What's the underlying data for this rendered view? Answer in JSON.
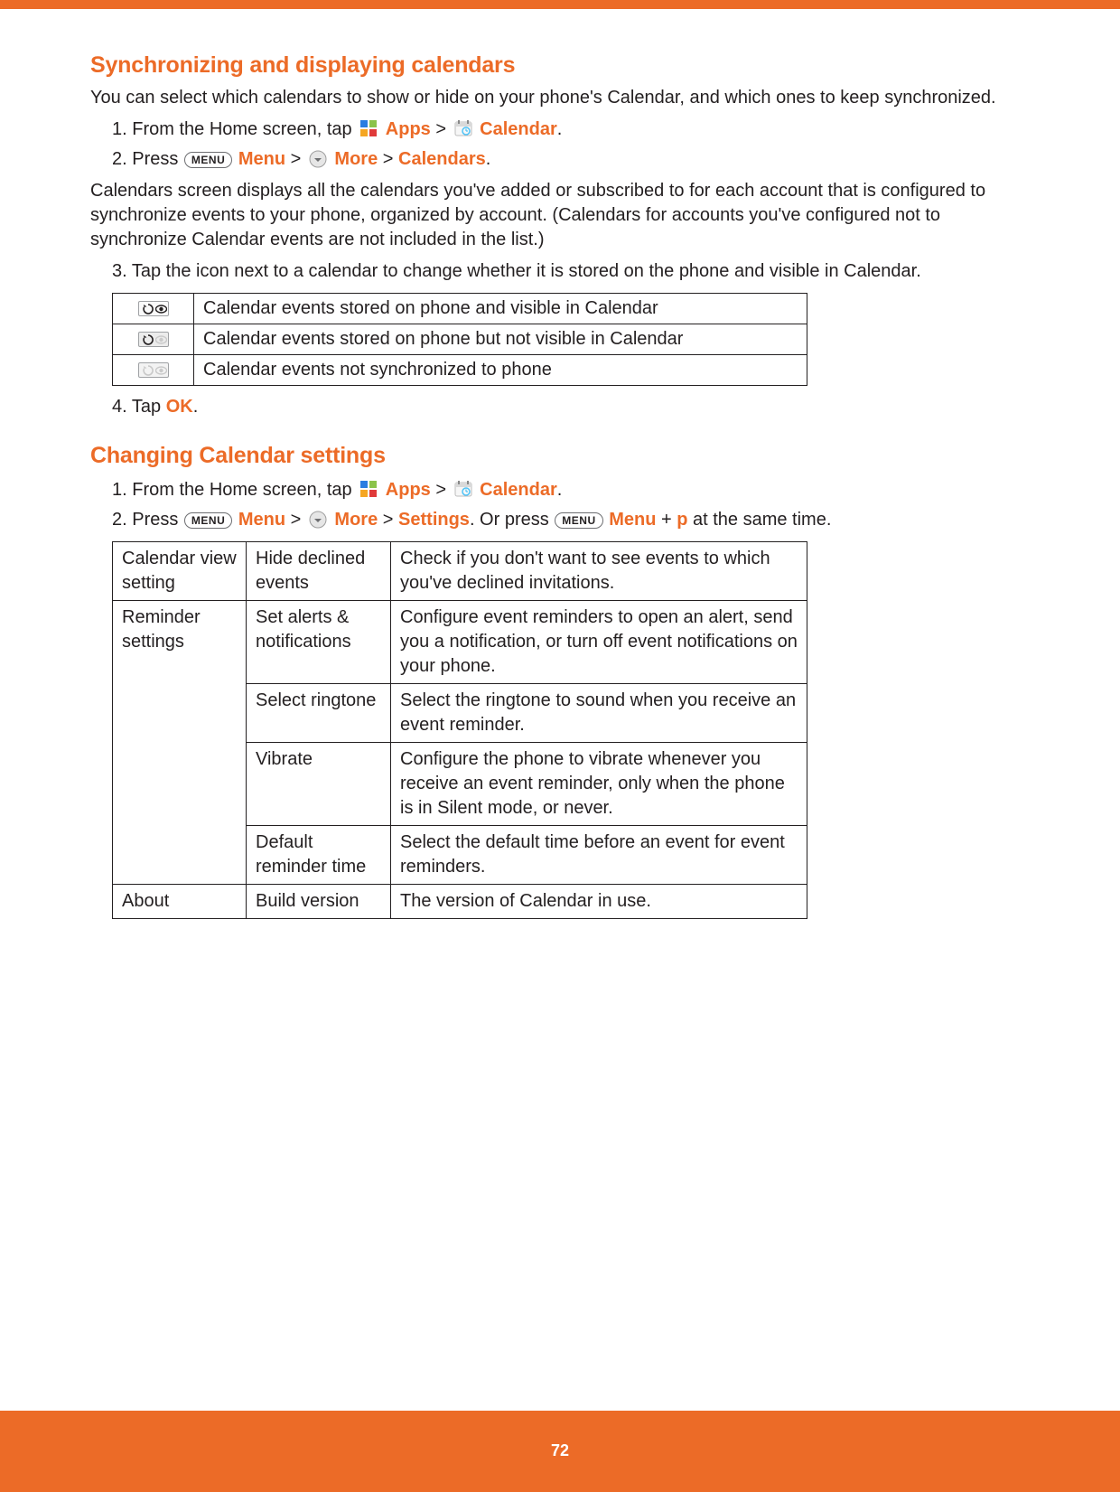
{
  "section1": {
    "title": "Synchronizing and displaying calendars",
    "intro": "You can select which calendars to show or hide on your phone's Calendar, and which ones to keep synchronized.",
    "step1_prefix": "1. From the Home screen, tap ",
    "apps_label": "Apps",
    "sep_gt": " > ",
    "calendar_label": "Calendar",
    "step2_prefix": "2. Press ",
    "menu_key": "MENU",
    "menu_label": "Menu",
    "more_label": "More",
    "calendars_label": "Calendars",
    "period": ".",
    "para2": "Calendars screen displays all the calendars you've added or subscribed to for each account that is configured to synchronize events to your phone, organized by account. (Calendars for accounts you've configured not to synchronize Calendar events are not included in the list.)",
    "step3": "3. Tap the icon next to a calendar to change whether it is stored on the phone and visible in Calendar.",
    "table": [
      "Calendar events stored on phone and visible in Calendar",
      "Calendar events stored on phone but not visible in Calendar",
      "Calendar events not synchronized to phone"
    ],
    "step4_prefix": "4. Tap ",
    "ok_label": "OK"
  },
  "section2": {
    "title": "Changing Calendar settings",
    "step1_prefix": "1. From the Home screen, tap ",
    "step2_prefix": "2. Press ",
    "settings_label": "Settings",
    "or_press": ". Or press ",
    "plus": " + ",
    "p_key": "p",
    "same_time": " at the same time.",
    "table": {
      "rows": [
        {
          "c1": "Calendar view setting",
          "c2": "Hide declined events",
          "c3": "Check if you don't want to see events to which you've declined invitations."
        },
        {
          "c1": "Reminder settings",
          "c2": "Set alerts & notifications",
          "c3": "Configure event reminders to open an alert, send you a notification, or turn off event notifications on your phone."
        },
        {
          "c1": "",
          "c2": "Select ringtone",
          "c3": "Select the ringtone to sound when you receive an event reminder."
        },
        {
          "c1": "",
          "c2": "Vibrate",
          "c3": "Configure the phone to vibrate whenever you receive an event reminder, only when the phone is in Silent mode, or never."
        },
        {
          "c1": "",
          "c2": "Default reminder time",
          "c3": "Select the default time before an event for event reminders."
        },
        {
          "c1": "About",
          "c2": "Build version",
          "c3": "The version of Calendar in use."
        }
      ]
    }
  },
  "page_number": "72"
}
